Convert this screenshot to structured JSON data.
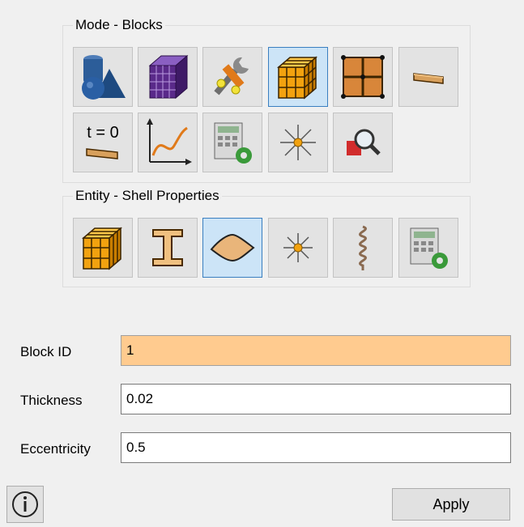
{
  "mode_group": {
    "title": "Mode - Blocks",
    "row1": [
      "geometry-icon",
      "mesh-cube-icon",
      "tools-icon",
      "blocks-cube-icon",
      "grid-nodes-icon",
      "shell-strip-icon"
    ],
    "row2": [
      "initial-time-icon",
      "curve-graph-icon",
      "calculator-gear-icon",
      "spider-icon",
      "inspect-icon"
    ]
  },
  "entity_group": {
    "title": "Entity - Shell Properties",
    "items": [
      "block-cube-icon",
      "beam-i-icon",
      "shell-surface-icon",
      "point-mass-icon",
      "spring-icon",
      "calculator-settings-icon"
    ]
  },
  "tb_text": {
    "t_zero": "t = 0"
  },
  "form": {
    "block_id": {
      "label": "Block ID",
      "value": "1"
    },
    "thickness": {
      "label": "Thickness",
      "value": "0.02"
    },
    "eccentricity": {
      "label": "Eccentricity",
      "value": "0.5"
    }
  },
  "buttons": {
    "apply": "Apply",
    "info_icon": "info-icon"
  },
  "colors": {
    "highlight_field": "#ffcb8f",
    "selected_tool": "#cce4f7",
    "selected_border": "#3a7fc0"
  }
}
